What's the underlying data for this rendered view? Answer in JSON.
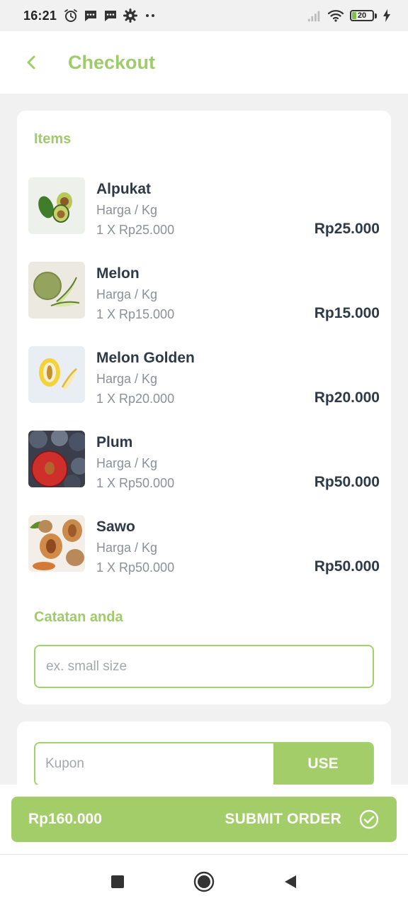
{
  "status_bar": {
    "time": "16:21",
    "battery_level": "20",
    "icons": [
      "alarm-icon",
      "message-icon",
      "message-icon",
      "settings-gear-icon",
      "more-dots-icon",
      "signal-icon",
      "wifi-icon",
      "battery-icon",
      "charging-bolt-icon"
    ]
  },
  "header": {
    "back_icon": "chevron-left-icon",
    "title": "Checkout"
  },
  "items_section": {
    "title": "Items",
    "items": [
      {
        "name": "Alpukat",
        "unit": "Harga / Kg",
        "quantity_line": "1  X  Rp25.000",
        "total": "Rp25.000",
        "image": "avocado-image"
      },
      {
        "name": "Melon",
        "unit": "Harga / Kg",
        "quantity_line": "1  X  Rp15.000",
        "total": "Rp15.000",
        "image": "melon-image"
      },
      {
        "name": "Melon Golden",
        "unit": "Harga / Kg",
        "quantity_line": "1  X  Rp20.000",
        "total": "Rp20.000",
        "image": "golden-melon-image"
      },
      {
        "name": "Plum",
        "unit": "Harga / Kg",
        "quantity_line": "1  X  Rp50.000",
        "total": "Rp50.000",
        "image": "plum-image"
      },
      {
        "name": "Sawo",
        "unit": "Harga / Kg",
        "quantity_line": "1  X  Rp50.000",
        "total": "Rp50.000",
        "image": "sapodilla-image"
      }
    ]
  },
  "notes": {
    "title": "Catatan anda",
    "placeholder": "ex. small size",
    "value": ""
  },
  "coupon": {
    "placeholder": "Kupon",
    "value": "",
    "button_label": "USE"
  },
  "submit": {
    "total": "Rp160.000",
    "label": "SUBMIT ORDER",
    "icon": "check-circle-icon"
  },
  "nav": {
    "recent_icon": "square-recents-icon",
    "home_icon": "circle-home-icon",
    "back_icon": "triangle-back-icon"
  },
  "colors": {
    "accent": "#9fcc6a",
    "button": "#a3cd69",
    "text_dark": "#2e3a47",
    "text_muted": "#8c9096",
    "background": "#f1f1f1"
  }
}
